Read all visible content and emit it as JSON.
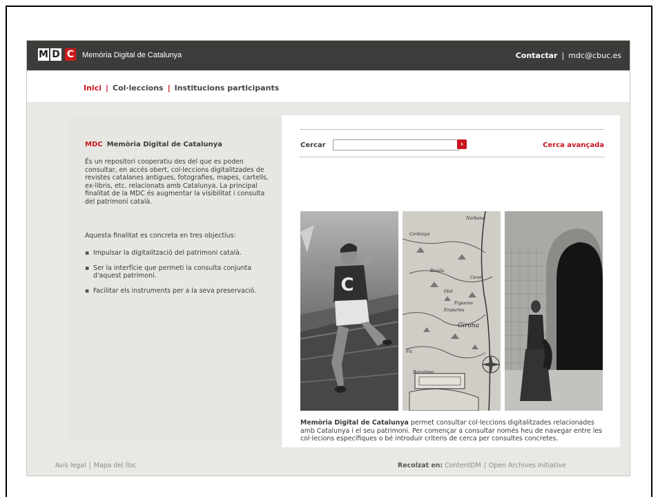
{
  "header": {
    "logo_letters": [
      "M",
      "D",
      "C"
    ],
    "site_title": "Memòria Digital de Catalunya",
    "contact_label": "Contactar",
    "separator": "|",
    "email": "mdc@cbuc.es"
  },
  "nav": {
    "items": [
      {
        "label": "Inici",
        "active": true
      },
      {
        "label": "Col·leccions",
        "active": false
      },
      {
        "label": "Institucions participants",
        "active": false
      }
    ],
    "separator": "|"
  },
  "left": {
    "heading_abbr": "MDC",
    "heading": "Memòria Digital de Catalunya",
    "intro": "És un repositori cooperatiu des del que es poden consultar, en accés obert, col·leccions digitalitzades de revistes catalanes antigues, fotografies, mapes, cartells, ex-libris, etc. relacionats amb Catalunya. La principal finalitat de la MDC és augmentar la visibilitat i consulta del patrimoni català.",
    "goal": "Aquesta finalitat es concreta en tres objectius:",
    "objectives": [
      "Impulsar la digitalització del patrimoni català.",
      "Ser la interfície que permeti la consulta conjunta d'aquest patrimoni.",
      "Facilitar els instruments per a la seva preservació."
    ]
  },
  "search": {
    "label": "Cercar",
    "value": "",
    "advanced_label": "Cerca avançada"
  },
  "photos": [
    {
      "alt": "athlete-photo",
      "jersey_letter": "C"
    },
    {
      "alt": "historic-map",
      "map_labels": [
        "Narbona",
        "Cerdanya",
        "Girona",
        "Vic",
        "Barcelona",
        "Ceret",
        "Olot",
        "Figueres",
        "Empuries",
        "Besalu"
      ]
    },
    {
      "alt": "woman-doorway-photo"
    }
  ],
  "description": {
    "bold": "Memòria Digital de Catalunya",
    "text": " permet consultar col·leccions digitalitzades relacionades amb Catalunya i el seu patrimoni. Per començar a consultar només heu de navegar entre les col·lecions específiques o bé introduir criteris de cerca per consultes concretes."
  },
  "footer": {
    "legal": "Avís legal",
    "sitemap": "Mapa del lloc",
    "separator": "|",
    "harvested_label": "Recolzat en:",
    "contentdm": "ContentDM",
    "oai": "Open Archives Initiative"
  },
  "colors": {
    "brand_red": "#c8141e",
    "header_bg": "#3d3c3a"
  }
}
